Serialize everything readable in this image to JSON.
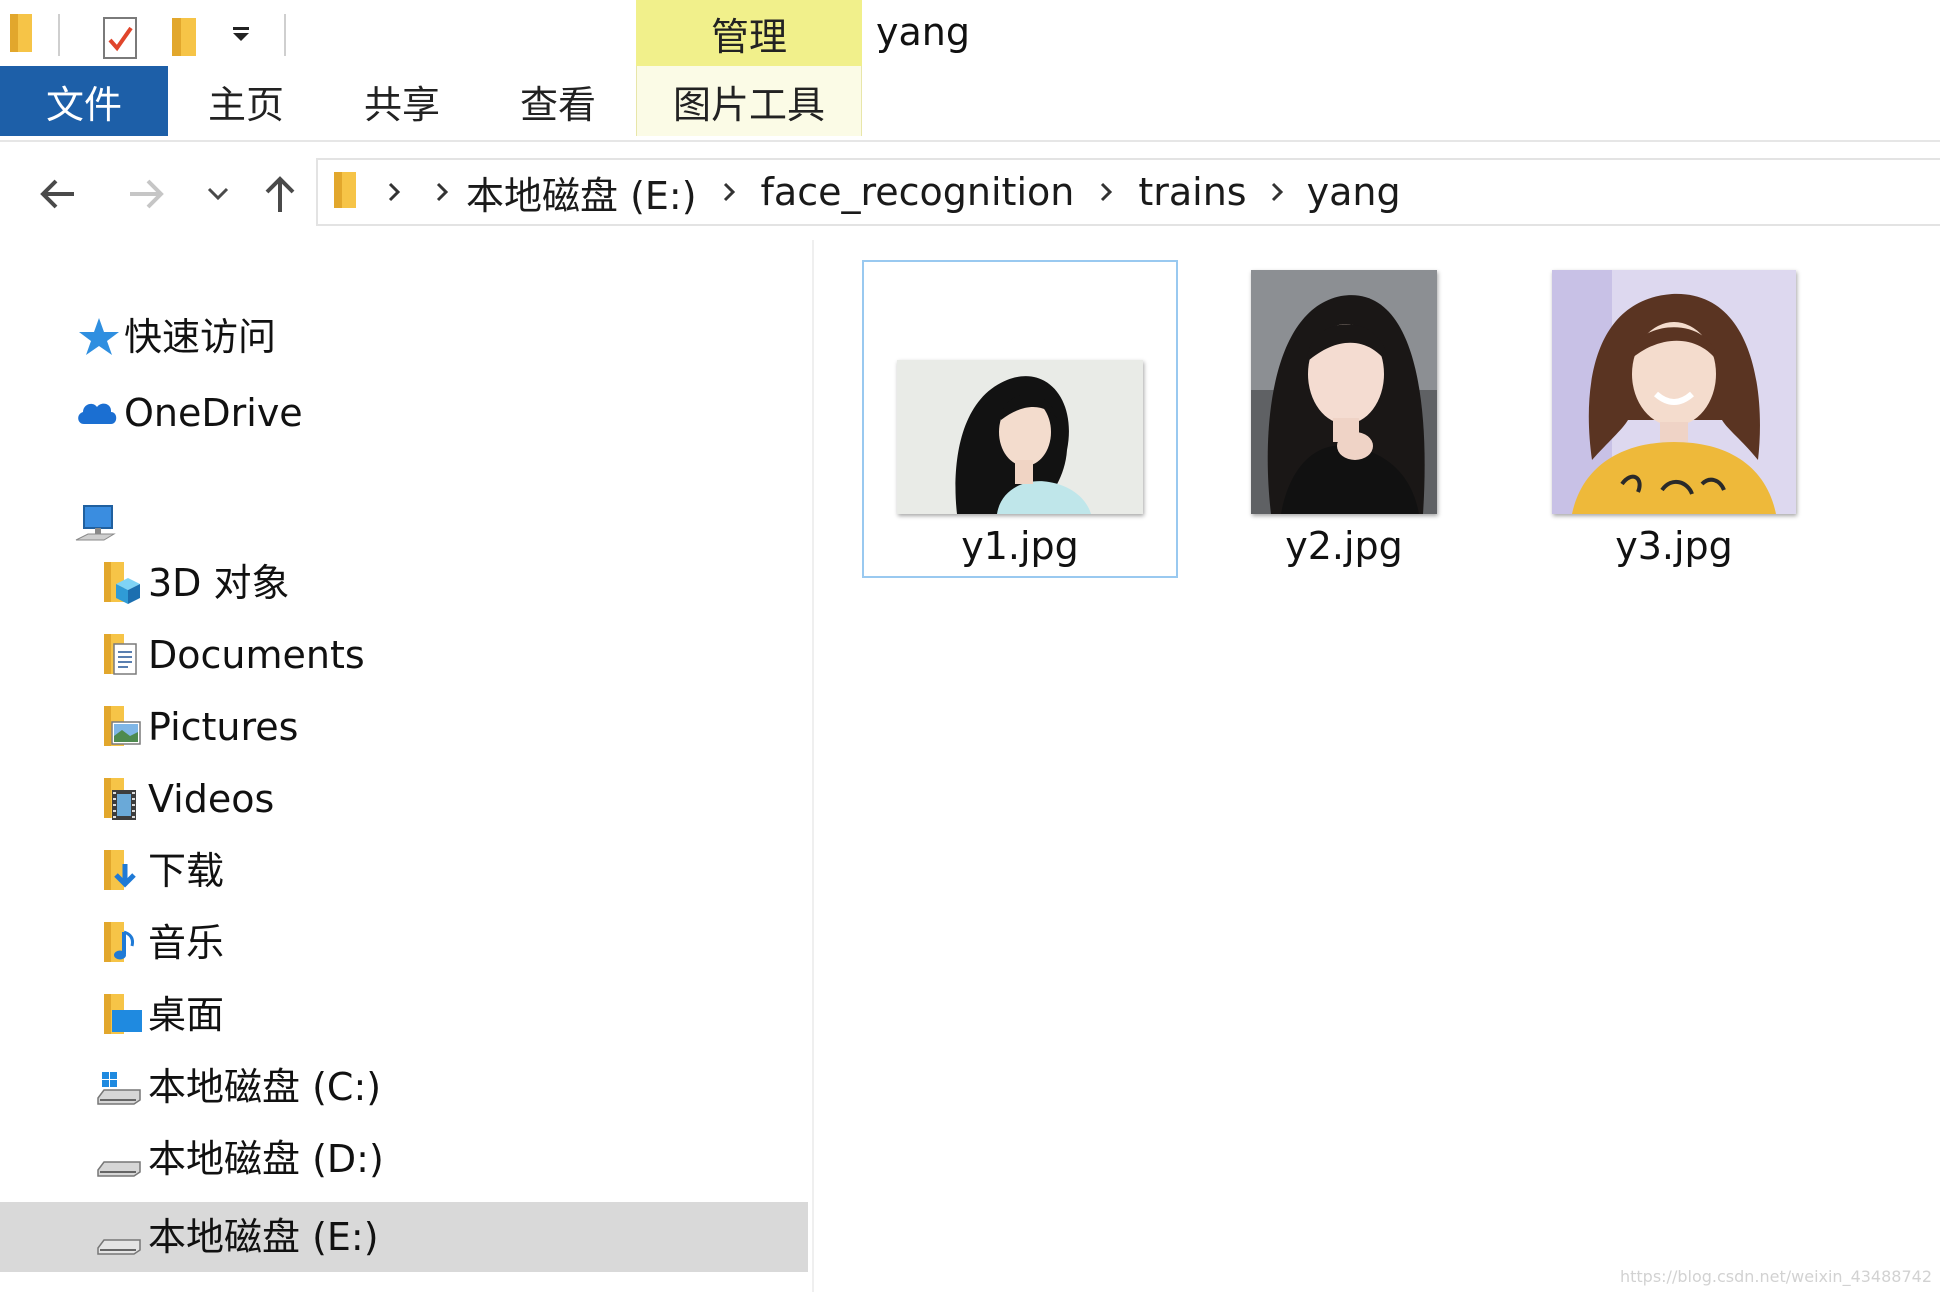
{
  "window": {
    "title": "yang",
    "manage_tab_label": "管理"
  },
  "ribbon": {
    "tabs": [
      {
        "label": "文件"
      },
      {
        "label": "主页"
      },
      {
        "label": "共享"
      },
      {
        "label": "查看"
      },
      {
        "label": "图片工具"
      }
    ]
  },
  "address": {
    "crumbs": [
      "本地磁盘 (E:)",
      "face_recognition",
      "trains",
      "yang"
    ]
  },
  "navpane": {
    "quick_access": "快速访问",
    "onedrive": "OneDrive",
    "pc_items": [
      {
        "label": "3D 对象",
        "icon": "3d-objects-icon"
      },
      {
        "label": "Documents",
        "icon": "documents-icon"
      },
      {
        "label": "Pictures",
        "icon": "pictures-icon"
      },
      {
        "label": "Videos",
        "icon": "videos-icon"
      },
      {
        "label": "下载",
        "icon": "downloads-icon"
      },
      {
        "label": "音乐",
        "icon": "music-icon"
      },
      {
        "label": "桌面",
        "icon": "desktop-icon"
      },
      {
        "label": "本地磁盘 (C:)",
        "icon": "system-drive-icon"
      },
      {
        "label": "本地磁盘 (D:)",
        "icon": "drive-icon"
      },
      {
        "label": "本地磁盘 (E:)",
        "icon": "drive-icon",
        "selected": true
      }
    ]
  },
  "files": [
    {
      "name": "y1.jpg",
      "selected": true
    },
    {
      "name": "y2.jpg"
    },
    {
      "name": "y3.jpg"
    }
  ],
  "watermark": "https://blog.csdn.net/weixin_43488742",
  "colors": {
    "file_tab": "#1d5fa8",
    "manage_tab": "#f1f08b",
    "selected_nav": "#d9d9d9",
    "selected_tile_border": "#99c9f0"
  }
}
